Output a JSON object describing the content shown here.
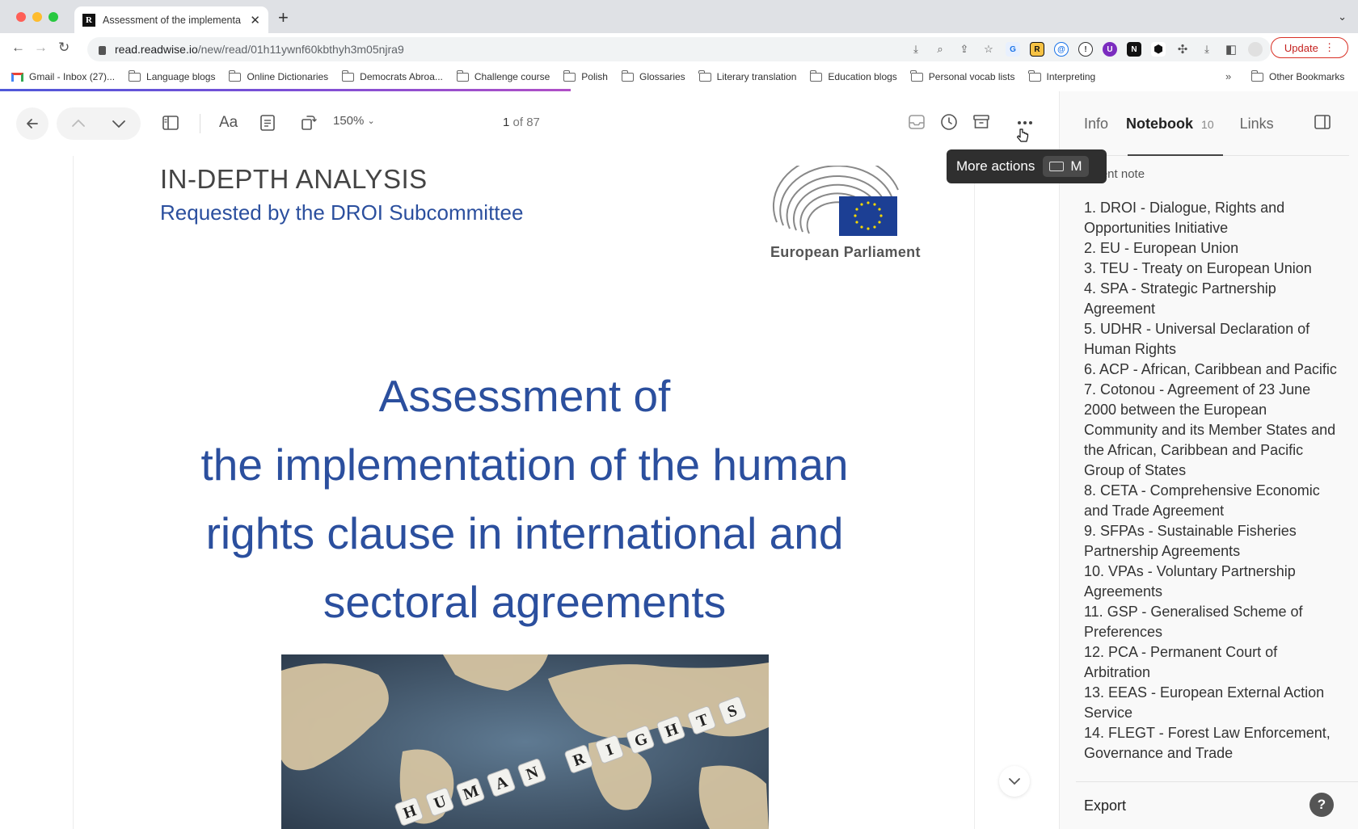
{
  "browser": {
    "tab_title": "Assessment of the implementa",
    "tab_favicon": "R",
    "url_host": "read.readwise.io",
    "url_path": "/new/read/01h11ywnf60kbthyh3m05njra9",
    "update_label": "Update"
  },
  "bookmarks": {
    "items": [
      {
        "label": "Gmail - Inbox (27)...",
        "icon": "gmail-icon"
      },
      {
        "label": "Language blogs",
        "icon": "folder-icon"
      },
      {
        "label": "Online Dictionaries",
        "icon": "folder-icon"
      },
      {
        "label": "Democrats Abroa...",
        "icon": "folder-icon"
      },
      {
        "label": "Challenge course",
        "icon": "folder-icon"
      },
      {
        "label": "Polish",
        "icon": "folder-icon"
      },
      {
        "label": "Glossaries",
        "icon": "folder-icon"
      },
      {
        "label": "Literary translation",
        "icon": "folder-icon"
      },
      {
        "label": "Education blogs",
        "icon": "folder-icon"
      },
      {
        "label": "Personal vocab lists",
        "icon": "folder-icon"
      },
      {
        "label": "Interpreting",
        "icon": "folder-icon"
      }
    ],
    "overflow": "»",
    "other": "Other Bookmarks"
  },
  "reader_progress": 0.42,
  "toolbar": {
    "font_label": "Aa",
    "zoom": "150%",
    "page_current": "1",
    "page_of": "of 87"
  },
  "tooltip": {
    "label": "More actions",
    "shortcut": "M"
  },
  "document": {
    "kicker": "IN-DEPTH ANALYSIS",
    "subtitle": "Requested by the DROI Subcommittee",
    "logo_text": "European Parliament",
    "title_lines": [
      "Assessment of",
      "the implementation of the human",
      "rights clause in international and",
      "sectoral agreements"
    ],
    "image_letters": "HUMAN RIGHTS"
  },
  "panel": {
    "tabs": {
      "info": "Info",
      "notebook": "Notebook",
      "notebook_count": "10",
      "links": "Links"
    },
    "note_label": "ument note",
    "notes": [
      "1. DROI - Dialogue, Rights and Opportunities Initiative",
      "2. EU - European Union",
      "3. TEU - Treaty on European Union",
      "4. SPA - Strategic Partnership Agreement",
      "5. UDHR - Universal Declaration of Human Rights",
      "6. ACP - African, Caribbean and Pacific",
      "7. Cotonou - Agreement of 23 June 2000 between the European Community and its Member States and the African, Caribbean and Pacific Group of States",
      "8. CETA - Comprehensive Economic and Trade Agreement",
      "9. SFPAs - Sustainable Fisheries Partnership Agreements",
      "10. VPAs - Voluntary Partnership Agreements",
      "11. GSP - Generalised Scheme of Preferences",
      "12. PCA - Permanent Court of Arbitration",
      "13. EEAS - European External Action Service",
      "14. FLEGT - Forest Law Enforcement, Governance and Trade"
    ],
    "export_label": "Export",
    "help_label": "?"
  }
}
